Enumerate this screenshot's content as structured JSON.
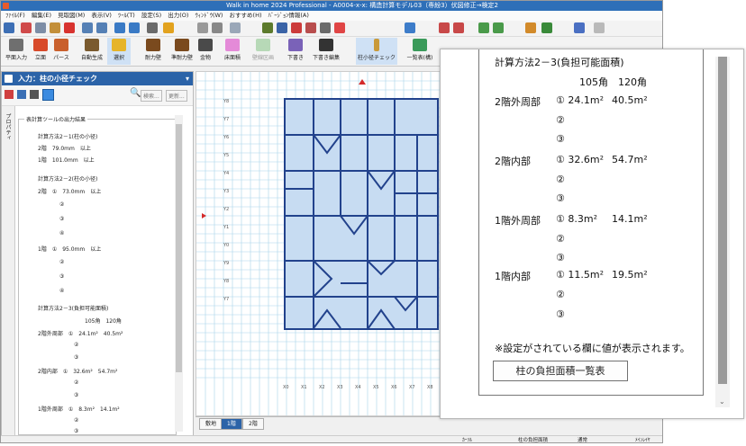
{
  "window": {
    "title": "Walk in home 2024 Professional - A0004-x-x: 構造計算モデル03（専紛3）伏図修正→検定2",
    "status": {
      "c1": "ｶｰｿﾙ",
      "c2": "柱の負担面積",
      "c3": "通常",
      "c4": "ﾒｲﾝﾚｲﾔ"
    }
  },
  "menubar": [
    "ﾌｧｲﾙ(F)",
    "編集(E)",
    "見取図(M)",
    "表示(V)",
    "ﾂｰﾙ(T)",
    "設定(S)",
    "出力(O)",
    "ｳｨﾝﾄﾞｳ(W)",
    "おすすめ(H)",
    "ﾊﾞｰｼﾞｮﾝ情報(A)"
  ],
  "toolbar2": [
    "平面入力",
    "立面",
    "パース",
    "自動生成",
    "選択",
    "耐力壁",
    "準耐力壁",
    "金物",
    "床面積",
    "壁線区画",
    "下書き",
    "下書き編集",
    "柱小径チェック",
    "一覧表(構)"
  ],
  "panel": {
    "title": "入力：柱の小径チェック",
    "side_tab": "プロパティ",
    "search_label": "検索...",
    "update_label": "更新...",
    "group_title": "表計算ツールの出力結果",
    "lines": [
      "計算方法2－1(柱の小径)",
      "2階　79.0mm　以上",
      "1階　101.0mm　以上",
      "計算方法2－2(柱の小径)",
      "2階　①　73.0mm　以上",
      "②",
      "③",
      "④",
      "1階　①　95.0mm　以上",
      "②",
      "③",
      "④",
      "計算方法2－3(負担可能面積)",
      "105角　120角",
      "2階外周部　①　24.1m²　40.5m²",
      "②",
      "③",
      "2階内部　①　32.6m²　54.7m²",
      "②",
      "③",
      "1階外周部　①　8.3m²　14.1m²",
      "②",
      "③"
    ]
  },
  "tabs": [
    "敷地",
    "1階",
    "2階"
  ],
  "zoom": {
    "heading": "計算方法2－3(負担可能面積)",
    "cols": "105角　120角",
    "rows": [
      {
        "label": "2階外周部",
        "v1": "① 24.1m²",
        "v2": "40.5m²"
      },
      {
        "label": "2階内部",
        "v1": "① 32.6m²",
        "v2": "54.7m²"
      },
      {
        "label": "1階外周部",
        "v1": "① 8.3m²",
        "v2": "14.1m²"
      },
      {
        "label": "1階内部",
        "v1": "① 11.5m²",
        "v2": "19.5m²"
      }
    ],
    "sub2": "②",
    "sub3": "③",
    "note": "※設定がされている欄に値が表示されます。",
    "button": "柱の負担面積一覧表"
  },
  "colors": {
    "title_blue": "#2e6fb8",
    "panel_head": "#2b63a8",
    "room_fill": "#c7dcf2",
    "wall": "#22428c",
    "grid": "#a8d4ea"
  },
  "icons": [
    "app-icon",
    "new-icon",
    "open-icon",
    "save-icon",
    "undo-icon",
    "redo-icon",
    "zoom-icon",
    "search-icon"
  ]
}
